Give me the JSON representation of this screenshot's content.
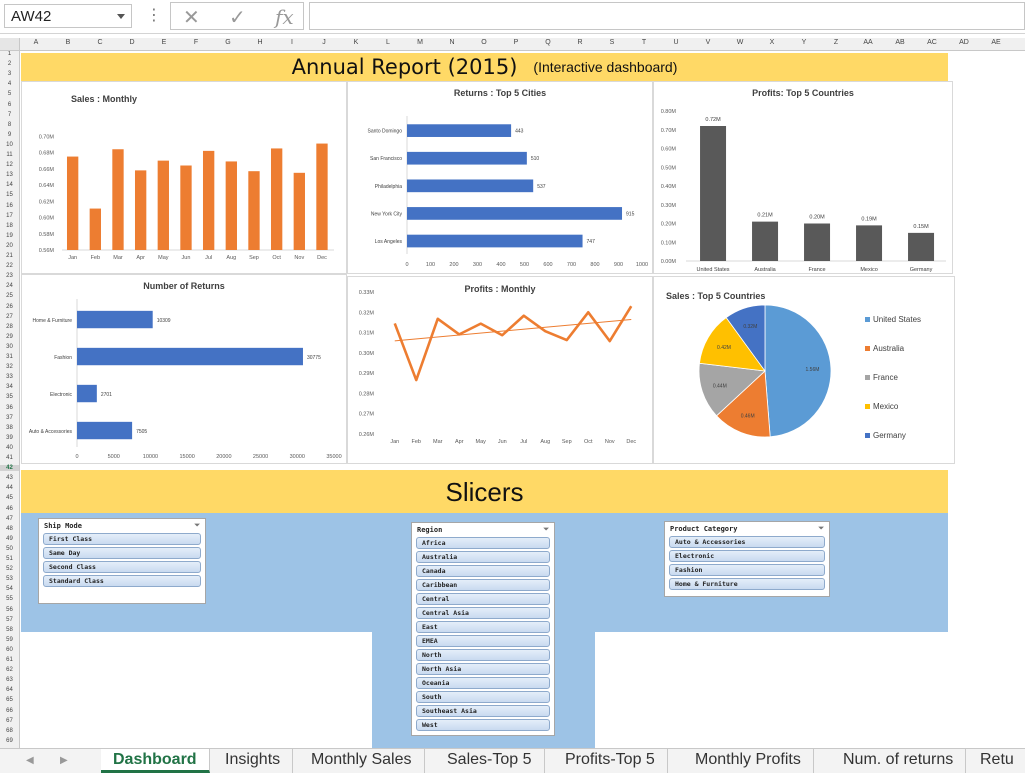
{
  "namebox": "AW42",
  "title": "Annual Report (2015)",
  "subtitle": "(Interactive dashboard)",
  "slicers_title": "Slicers",
  "columns": [
    "A",
    "B",
    "C",
    "D",
    "E",
    "F",
    "G",
    "H",
    "I",
    "J",
    "K",
    "L",
    "M",
    "N",
    "O",
    "P",
    "Q",
    "R",
    "S",
    "T",
    "U",
    "V",
    "W",
    "X",
    "Y",
    "Z",
    "AA",
    "AB",
    "AC",
    "AD",
    "AE"
  ],
  "rows_max": 69,
  "active_row": 42,
  "charts": {
    "sales_monthly": {
      "type": "bar",
      "title": "Sales : Monthly",
      "categories": [
        "Jan",
        "Feb",
        "Mar",
        "Apr",
        "May",
        "Jun",
        "Jul",
        "Aug",
        "Sep",
        "Oct",
        "Nov",
        "Dec"
      ],
      "values": [
        0.675,
        0.611,
        0.684,
        0.658,
        0.67,
        0.664,
        0.682,
        0.669,
        0.657,
        0.685,
        0.655,
        0.691
      ],
      "ylim": [
        0.56,
        0.72
      ],
      "yticks": [
        "0.56M",
        "0.58M",
        "0.60M",
        "0.62M",
        "0.64M",
        "0.66M",
        "0.68M",
        "0.70M"
      ],
      "color": "#ed7d31"
    },
    "returns_cities": {
      "type": "bar",
      "title": "Returns : Top 5 Cities",
      "categories": [
        "Santo Domingo",
        "San Francisco",
        "Philadelphia",
        "New York City",
        "Los Angeles"
      ],
      "values": [
        443,
        510,
        537,
        915,
        747
      ],
      "xlim": [
        0,
        1000
      ],
      "xticks": [
        "0",
        "100",
        "200",
        "300",
        "400",
        "500",
        "600",
        "700",
        "800",
        "900",
        "1000"
      ],
      "color": "#4472c4"
    },
    "profits_countries": {
      "type": "bar",
      "title": "Profits: Top 5 Countries",
      "categories": [
        "United States",
        "Australia",
        "France",
        "Mexico",
        "Germany"
      ],
      "values": [
        0.72,
        0.21,
        0.2,
        0.19,
        0.15
      ],
      "labels": [
        "0.72M",
        "0.21M",
        "0.20M",
        "0.19M",
        "0.15M"
      ],
      "ylim": [
        0,
        0.8
      ],
      "yticks": [
        "0.00M",
        "0.10M",
        "0.20M",
        "0.30M",
        "0.40M",
        "0.50M",
        "0.60M",
        "0.70M",
        "0.80M"
      ],
      "color": "#595959"
    },
    "num_returns": {
      "type": "bar",
      "title": "Number of Returns",
      "categories": [
        "Home & Furniture",
        "Fashion",
        "Electronic",
        "Auto & Accessories"
      ],
      "values": [
        10309,
        30775,
        2701,
        7505
      ],
      "xlim": [
        0,
        35000
      ],
      "xticks": [
        "0",
        "5000",
        "10000",
        "15000",
        "20000",
        "25000",
        "30000",
        "35000"
      ],
      "color": "#4472c4"
    },
    "profits_monthly": {
      "type": "line",
      "title": "Profits : Monthly",
      "categories": [
        "Jan",
        "Feb",
        "Mar",
        "Apr",
        "May",
        "Jun",
        "Jul",
        "Aug",
        "Sep",
        "Oct",
        "Nov",
        "Dec"
      ],
      "values": [
        0.3145,
        0.2866,
        0.3168,
        0.3091,
        0.3144,
        0.3087,
        0.3183,
        0.3107,
        0.3063,
        0.32,
        0.3058,
        0.323
      ],
      "ylim": [
        0.26,
        0.33
      ],
      "yticks": [
        "0.26M",
        "0.27M",
        "0.28M",
        "0.29M",
        "0.30M",
        "0.31M",
        "0.32M",
        "0.33M"
      ],
      "color": "#ed7d31"
    },
    "sales_countries": {
      "type": "pie",
      "title": "Sales : Top 5 Countries",
      "categories": [
        "United States",
        "Australia",
        "France",
        "Mexico",
        "Germany"
      ],
      "values": [
        1.56,
        0.46,
        0.44,
        0.42,
        0.32
      ],
      "labels": [
        "1.56M",
        "0.46M",
        "0.44M",
        "0.42M",
        "0.32M"
      ],
      "colors": [
        "#5b9bd5",
        "#ed7d31",
        "#a5a5a5",
        "#ffc000",
        "#4472c4"
      ]
    }
  },
  "slicers": {
    "ship_mode": {
      "header": "Ship Mode",
      "items": [
        "First Class",
        "Same Day",
        "Second Class",
        "Standard Class"
      ]
    },
    "region": {
      "header": "Region",
      "items": [
        "Africa",
        "Australia",
        "Canada",
        "Caribbean",
        "Central",
        "Central Asia",
        "East",
        "EMEA",
        "North",
        "North Asia",
        "Oceania",
        "South",
        "Southeast Asia",
        "West"
      ]
    },
    "product_category": {
      "header": "Product Category",
      "items": [
        "Auto & Accessories",
        "Electronic",
        "Fashion",
        "Home & Furniture"
      ]
    }
  },
  "tabs": [
    "Dashboard",
    "Insights",
    "Monthly Sales",
    "Sales-Top 5",
    "Profits-Top 5",
    "Monthly Profits",
    "Num. of returns",
    "Retu"
  ],
  "active_tab": 0
}
